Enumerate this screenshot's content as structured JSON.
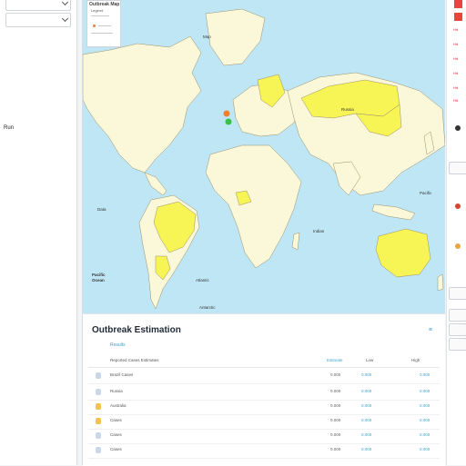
{
  "sidebar": {
    "label": "Run"
  },
  "map": {
    "legend": {
      "title": "Outbreak Map",
      "subtitle": "Legend"
    },
    "labels": {
      "north_atlantic": "Map",
      "north_america": "Data",
      "south_pacific_1": "Pacific",
      "south_pacific_2": "Ocean",
      "south_atlantic": "Atlantic",
      "indian_ocean": "Indian",
      "pacific_right": "Pacific",
      "russia": "Russia",
      "antarctic": "Antarctic"
    },
    "colors": {
      "ocean": "#bfe6f5",
      "land": "#fbf8d9",
      "highlight": "#f7f456",
      "border": "#9a8f6a",
      "marker_orange": "#f07f2d",
      "marker_green": "#3bbf4a"
    }
  },
  "panel": {
    "title": "Outbreak Estimation",
    "action": "≡",
    "subtitle": "Results",
    "columns": [
      "Reported Cases Estimates",
      "Estimate",
      "Low",
      "High"
    ],
    "rows": [
      {
        "name": "Brazil  Cases",
        "estimate": "0.000",
        "low": "0.000",
        "high": "0.000",
        "icon_color": "#c9d7e8"
      },
      {
        "name": "Russia",
        "estimate": "0.000",
        "low": "0.000",
        "high": "0.000",
        "icon_color": "#f4c34f"
      },
      {
        "name": "Australia",
        "estimate": "0.000",
        "low": "0.000",
        "high": "0.000",
        "icon_color": "#f4c34f"
      },
      {
        "name": "Cases",
        "estimate": "0.000",
        "low": "0.000",
        "high": "0.000",
        "icon_color": "#f4c34f"
      },
      {
        "name": "Cases",
        "estimate": "0.000",
        "low": "0.000",
        "high": "0.000",
        "icon_color": "#c9d7e8"
      },
      {
        "name": "Cases",
        "estimate": "0.000",
        "low": "0.000",
        "high": "0.000",
        "icon_color": "#c9d7e8"
      }
    ]
  },
  "rail": {
    "items": [
      "Hit",
      "Hit",
      "Hit",
      "Hit",
      "Hit",
      "Hit"
    ]
  }
}
